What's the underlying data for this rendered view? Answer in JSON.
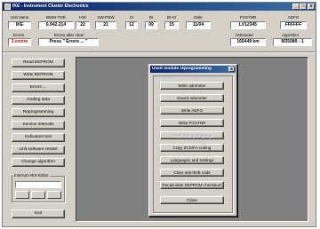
{
  "window": {
    "title": "IKE - Instrument Cluster Electronics",
    "minimize": "_",
    "maximize": "□",
    "close": "x"
  },
  "info_row1": {
    "headers": [
      "Unit name",
      "BMW-TNR",
      "HW",
      "SW-PSW",
      "CI",
      "DI",
      "BI-VI",
      "Date",
      "FGSTNR",
      "ADFG"
    ],
    "values": [
      "IKE",
      "6.942.214",
      "22",
      "21",
      "12",
      "09",
      "15",
      "11/04",
      "LV12345",
      "FFFFFF"
    ]
  },
  "info_row2": {
    "errors_label": "Errors",
    "errors_after_clear_label": "Errors after clear",
    "odometer_label": "Odometer",
    "algorithm_label": "Algorithm",
    "errors_value": "3 errors",
    "errors_after_clear_value": "Press \" Errors ... \"",
    "odometer_value": "165449 km",
    "algorithm_value": "M35080 - 1"
  },
  "left_buttons": [
    "Read EEPROM",
    "Write EEPROM",
    "Errors ...",
    "Coding data",
    "Reprogramming",
    "Service intervals",
    "Indicators test",
    "Unit software restart",
    "Change algorithm"
  ],
  "hex_editor": {
    "label": "Internal HEX-Editor",
    "value": "",
    "btn1": "",
    "btn2": "",
    "btn3": ""
  },
  "exit_button": "Exit",
  "dialog": {
    "title": "Used module reprogramming",
    "close": "x",
    "buttons": [
      {
        "label": "Write odometer",
        "enabled": true
      },
      {
        "label": "Saved odometer",
        "enabled": true
      },
      {
        "label": "Write ADFG",
        "enabled": true
      },
      {
        "label": "Write FGSTNR",
        "enabled": true
      },
      {
        "label": "Flash dialog language",
        "enabled": false
      },
      {
        "label": "Copy ZCS/FA coding",
        "enabled": true
      },
      {
        "label": "Languages and settings",
        "enabled": true
      },
      {
        "label": "Clear anti-theft code",
        "enabled": true
      },
      {
        "label": "Recalculate EEPROM checksum",
        "enabled": true
      },
      {
        "label": "Close",
        "enabled": true
      }
    ]
  }
}
